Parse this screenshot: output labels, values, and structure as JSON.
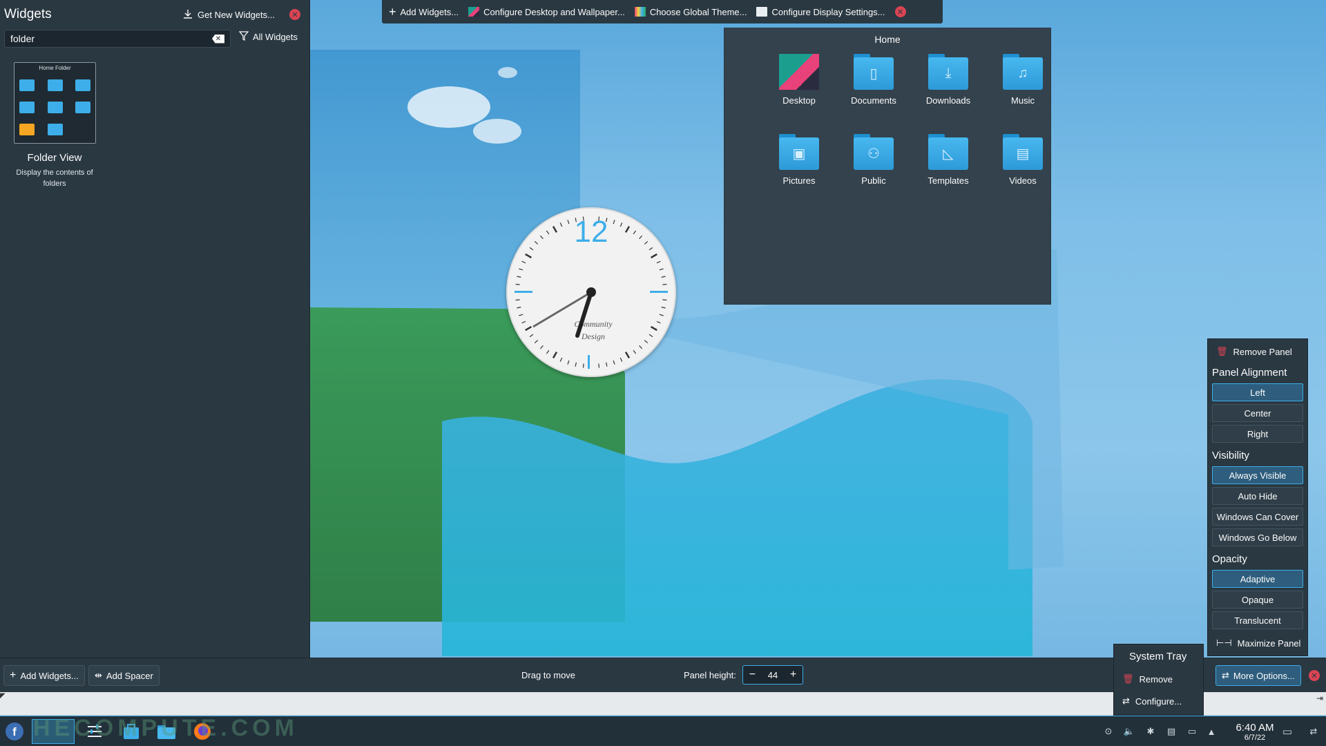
{
  "widgets_panel": {
    "title": "Widgets",
    "get_new": "Get New Widgets...",
    "search_value": "folder",
    "filter": "All Widgets",
    "card_label": "Home Folder",
    "widget_name": "Folder View",
    "widget_desc": "Display the contents of folders"
  },
  "top_toolbar": {
    "add_widgets": "Add Widgets...",
    "configure_desktop": "Configure Desktop and Wallpaper...",
    "global_theme": "Choose Global Theme...",
    "display_settings": "Configure Display Settings..."
  },
  "home_widget": {
    "title": "Home",
    "items": [
      {
        "label": "Desktop",
        "icon": "desktop-folder-icon"
      },
      {
        "label": "Documents",
        "icon": "documents-folder-icon"
      },
      {
        "label": "Downloads",
        "icon": "downloads-folder-icon"
      },
      {
        "label": "Music",
        "icon": "music-folder-icon"
      },
      {
        "label": "Pictures",
        "icon": "pictures-folder-icon"
      },
      {
        "label": "Public",
        "icon": "public-folder-icon"
      },
      {
        "label": "Templates",
        "icon": "templates-folder-icon"
      },
      {
        "label": "Videos",
        "icon": "videos-folder-icon"
      }
    ]
  },
  "clock_widget": {
    "numeral": "12",
    "caption_line1": "Community",
    "caption_line2": "Design"
  },
  "edit_bar": {
    "add_widgets": "Add Widgets...",
    "add_spacer": "Add Spacer",
    "drag_label": "Drag to move",
    "height_label": "Panel height:",
    "height_value": "44",
    "more_options": "More Options..."
  },
  "options_menu": {
    "remove_panel": "Remove Panel",
    "alignment_head": "Panel Alignment",
    "alignment": [
      "Left",
      "Center",
      "Right"
    ],
    "alignment_selected": "Left",
    "visibility_head": "Visibility",
    "visibility": [
      "Always Visible",
      "Auto Hide",
      "Windows Can Cover",
      "Windows Go Below"
    ],
    "visibility_selected": "Always Visible",
    "opacity_head": "Opacity",
    "opacity": [
      "Adaptive",
      "Opaque",
      "Translucent"
    ],
    "opacity_selected": "Adaptive",
    "maximize": "Maximize Panel"
  },
  "tray_menu": {
    "title": "System Tray",
    "remove": "Remove",
    "configure": "Configure..."
  },
  "taskbar": {
    "watermark": "HECOMPUTE.COM",
    "time": "6:40 AM",
    "date": "6/7/22"
  },
  "colors": {
    "accent": "#3daee9",
    "panel_bg": "#2a3842",
    "close_red": "#da4453"
  }
}
